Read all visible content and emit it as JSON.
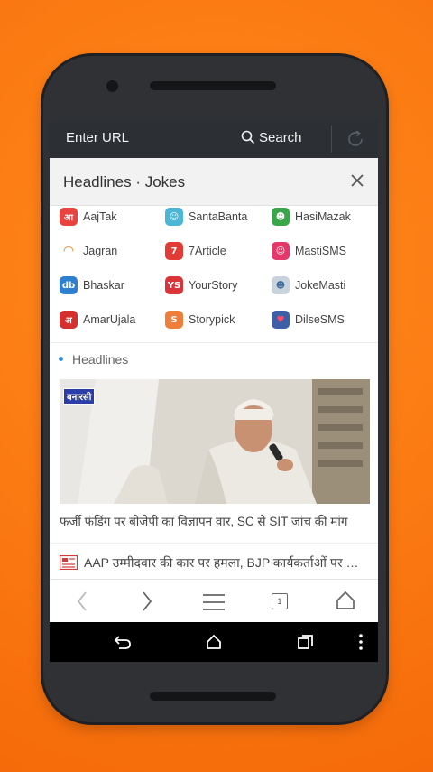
{
  "urlbar": {
    "url_placeholder": "Enter URL",
    "search_label": "Search"
  },
  "panel": {
    "title": "Headlines · Jokes"
  },
  "quicklinks": [
    {
      "label": "AajTak",
      "icon": "aajtak-icon",
      "color": "#e8433f",
      "glyph": "आ"
    },
    {
      "label": "SantaBanta",
      "icon": "santabanta-icon",
      "color": "#4bb6d6",
      "glyph": "☺"
    },
    {
      "label": "HasiMazak",
      "icon": "hasimazak-icon",
      "color": "#3aa64a",
      "glyph": "☻"
    },
    {
      "label": "Jagran",
      "icon": "jagran-icon",
      "color": "#ffffff",
      "glyph": "◠"
    },
    {
      "label": "7Article",
      "icon": "7article-icon",
      "color": "#e23a35",
      "glyph": "7"
    },
    {
      "label": "MastiSMS",
      "icon": "mastisms-icon",
      "color": "#e6376a",
      "glyph": "☺"
    },
    {
      "label": "Bhaskar",
      "icon": "bhaskar-icon",
      "color": "#2f7fd0",
      "glyph": "db"
    },
    {
      "label": "YourStory",
      "icon": "yourstory-icon",
      "color": "#d8343a",
      "glyph": "YS"
    },
    {
      "label": "JokeMasti",
      "icon": "jokemasti-icon",
      "color": "#c9d3de",
      "glyph": "☻"
    },
    {
      "label": "AmarUjala",
      "icon": "amarujala-icon",
      "color": "#d3302e",
      "glyph": "अ"
    },
    {
      "label": "Storypick",
      "icon": "storypick-icon",
      "color": "#ef7e3a",
      "glyph": "S"
    },
    {
      "label": "DilseSMS",
      "icon": "dilsesms-icon",
      "color": "#3d5fa8",
      "glyph": "♥"
    }
  ],
  "headlines": {
    "section_label": "Headlines",
    "image_tag": "बनारसी",
    "item1": "फर्जी फंडिंग पर बीजेपी का विज्ञापन वार, SC से SIT जांच की मांग",
    "item2": "AAP उम्मीदवार की कार पर हमला, BJP कार्यकर्ताओं पर आरोप"
  },
  "toolbar": {
    "tab_count": "1"
  }
}
